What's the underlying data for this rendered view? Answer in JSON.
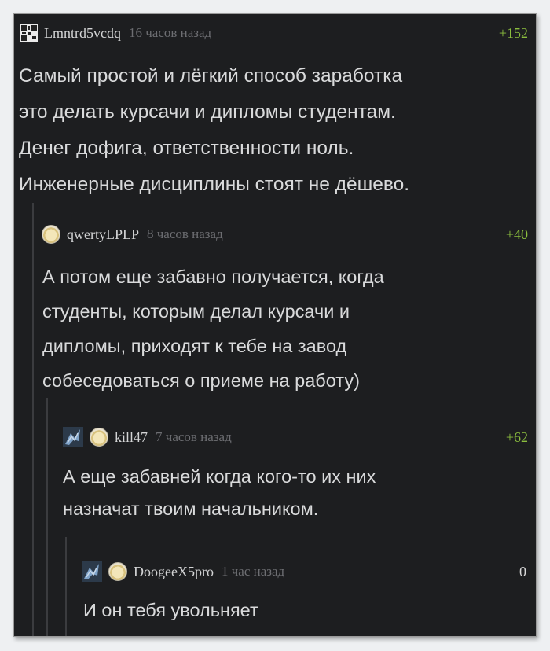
{
  "comments": [
    {
      "user": "Lmntrd5vcdq",
      "time": "16 часов назад",
      "rating": "+152",
      "lines": [
        "Самый простой и лёгкий способ заработка",
        "это делать курсачи и дипломы студентам.",
        "Денег дофига, ответственности ноль.",
        "Инженерные дисциплины стоят не дёшево."
      ]
    },
    {
      "user": "qwertyLPLP",
      "time": "8 часов назад",
      "rating": "+40",
      "lines": [
        "А потом еще забавно получается, когда",
        "студенты, которым делал курсачи и",
        "дипломы, приходят к тебе на завод",
        "собеседоваться о приеме на работу)"
      ]
    },
    {
      "user": "kill47",
      "time": "7 часов назад",
      "rating": "+62",
      "lines": [
        "А еще забавней когда кого-то их них",
        "назначат твоим начальником."
      ]
    },
    {
      "user": "DoogeeX5pro",
      "time": "1 час назад",
      "rating": "0",
      "lines": [
        "И он тебя увольняет"
      ]
    }
  ],
  "colors": {
    "background": "#1d1e20",
    "positive_rating": "#8bbd3e",
    "text": "#d9dadb",
    "muted": "#6d6e72"
  }
}
